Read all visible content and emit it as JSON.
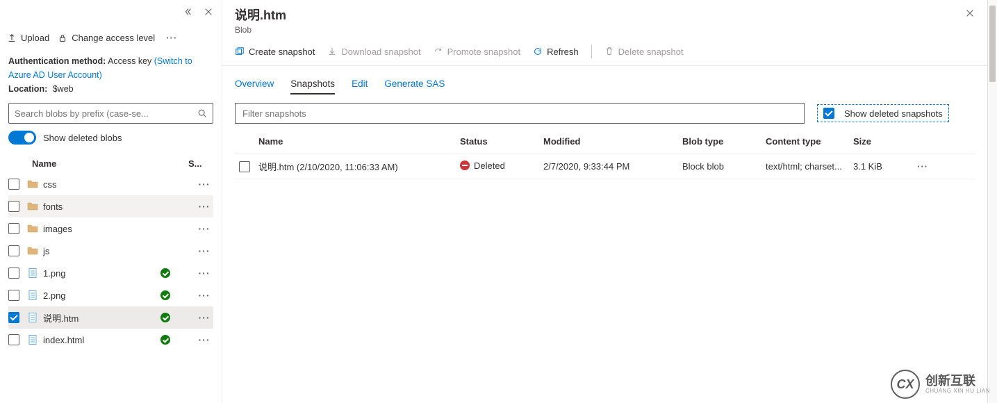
{
  "leftPanel": {
    "upload": "Upload",
    "changeAccess": "Change access level",
    "authLabel": "Authentication method:",
    "authValue": "Access key",
    "switchLink": "(Switch to Azure AD User Account)",
    "locationLabel": "Location:",
    "locationValue": "$web",
    "searchPlaceholder": "Search blobs by prefix (case-se...",
    "showDeleted": "Show deleted blobs",
    "colName": "Name",
    "colStatus": "S...",
    "items": [
      {
        "name": "css",
        "type": "folder",
        "status": "",
        "selected": false,
        "hover": false
      },
      {
        "name": "fonts",
        "type": "folder",
        "status": "",
        "selected": false,
        "hover": true
      },
      {
        "name": "images",
        "type": "folder",
        "status": "",
        "selected": false,
        "hover": false
      },
      {
        "name": "js",
        "type": "folder",
        "status": "",
        "selected": false,
        "hover": false
      },
      {
        "name": "1.png",
        "type": "file",
        "status": "ok",
        "selected": false,
        "hover": false
      },
      {
        "name": "2.png",
        "type": "file",
        "status": "ok",
        "selected": false,
        "hover": false
      },
      {
        "name": "说明.htm",
        "type": "file",
        "status": "ok",
        "selected": true,
        "hover": false
      },
      {
        "name": "index.html",
        "type": "file",
        "status": "ok",
        "selected": false,
        "hover": false
      }
    ]
  },
  "detail": {
    "title": "说明.htm",
    "subtitle": "Blob",
    "toolbar": {
      "createSnapshot": "Create snapshot",
      "downloadSnapshot": "Download snapshot",
      "promoteSnapshot": "Promote snapshot",
      "refresh": "Refresh",
      "deleteSnapshot": "Delete snapshot"
    },
    "tabs": {
      "overview": "Overview",
      "snapshots": "Snapshots",
      "edit": "Edit",
      "generateSAS": "Generate SAS"
    },
    "filterPlaceholder": "Filter snapshots",
    "showDeletedSnapshots": "Show deleted snapshots",
    "columns": {
      "name": "Name",
      "status": "Status",
      "modified": "Modified",
      "blobType": "Blob type",
      "contentType": "Content type",
      "size": "Size"
    },
    "rows": [
      {
        "name": "说明.htm (2/10/2020, 11:06:33 AM)",
        "status": "Deleted",
        "modified": "2/7/2020, 9:33:44 PM",
        "blobType": "Block blob",
        "contentType": "text/html; charset...",
        "size": "3.1 KiB"
      }
    ]
  },
  "watermark": {
    "main": "创新互联",
    "sub": "CHUANG XIN HU LIAN",
    "logo": "CX"
  }
}
